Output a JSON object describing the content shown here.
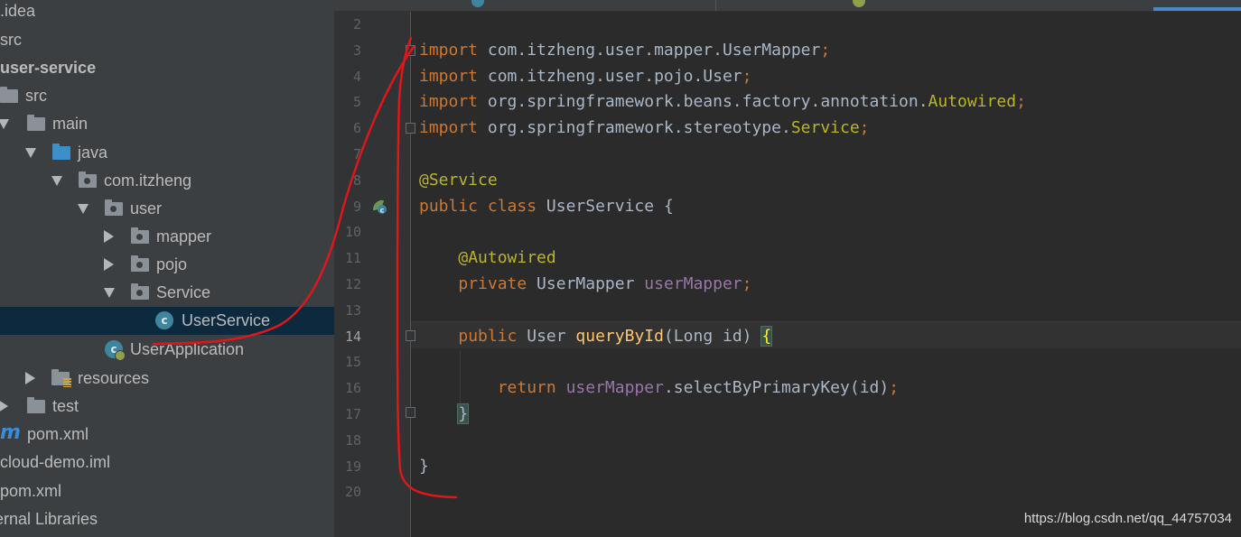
{
  "project_tree": [
    {
      "label": ".idea",
      "type": "plain"
    },
    {
      "label": "src",
      "type": "plain"
    },
    {
      "label": "user-service",
      "type": "module",
      "bold": true
    },
    {
      "label": "src",
      "type": "folder",
      "arrow": "down"
    },
    {
      "label": "main",
      "type": "folder",
      "arrow": "down"
    },
    {
      "label": "java",
      "type": "source-folder",
      "arrow": "down"
    },
    {
      "label": "com.itzheng",
      "type": "package",
      "arrow": "down"
    },
    {
      "label": "user",
      "type": "package",
      "arrow": "down"
    },
    {
      "label": "mapper",
      "type": "package",
      "arrow": "right"
    },
    {
      "label": "pojo",
      "type": "package",
      "arrow": "right"
    },
    {
      "label": "Service",
      "type": "package",
      "arrow": "down"
    },
    {
      "label": "UserService",
      "type": "class",
      "selected": true
    },
    {
      "label": "UserApplication",
      "type": "app-class"
    },
    {
      "label": "resources",
      "type": "resources-folder",
      "arrow": "right"
    },
    {
      "label": "test",
      "type": "folder",
      "arrow": "right"
    },
    {
      "label": "pom.xml",
      "type": "maven"
    },
    {
      "label": "cloud-demo.iml",
      "type": "plain"
    },
    {
      "label": "pom.xml",
      "type": "plain"
    },
    {
      "label": "ernal Libraries",
      "type": "plain"
    }
  ],
  "editor": {
    "current_line": 14,
    "lines": [
      {
        "n": "2",
        "text": ""
      },
      {
        "n": "3",
        "text": "import com.itzheng.user.mapper.UserMapper;"
      },
      {
        "n": "4",
        "text": "import com.itzheng.user.pojo.User;"
      },
      {
        "n": "5",
        "text": "import org.springframework.beans.factory.annotation.Autowired;"
      },
      {
        "n": "6",
        "text": "import org.springframework.stereotype.Service;"
      },
      {
        "n": "7",
        "text": ""
      },
      {
        "n": "8",
        "text": "@Service"
      },
      {
        "n": "9",
        "text": "public class UserService {"
      },
      {
        "n": "10",
        "text": ""
      },
      {
        "n": "11",
        "text": "    @Autowired"
      },
      {
        "n": "12",
        "text": "    private UserMapper userMapper;"
      },
      {
        "n": "13",
        "text": ""
      },
      {
        "n": "14",
        "text": "    public User queryById(Long id) {"
      },
      {
        "n": "15",
        "text": ""
      },
      {
        "n": "16",
        "text": "        return userMapper.selectByPrimaryKey(id);"
      },
      {
        "n": "17",
        "text": "    }"
      },
      {
        "n": "18",
        "text": ""
      },
      {
        "n": "19",
        "text": "}"
      },
      {
        "n": "20",
        "text": ""
      }
    ]
  },
  "icons": {
    "class_icon_glyph": "c",
    "maven_icon_glyph": "m"
  },
  "watermark": "https://blog.csdn.net/qq_44757034",
  "colors": {
    "keyword": "#cc7832",
    "annotation": "#bbb529",
    "field": "#9876aa",
    "method": "#ffc66d",
    "annotation_stroke": "#e0161a"
  }
}
